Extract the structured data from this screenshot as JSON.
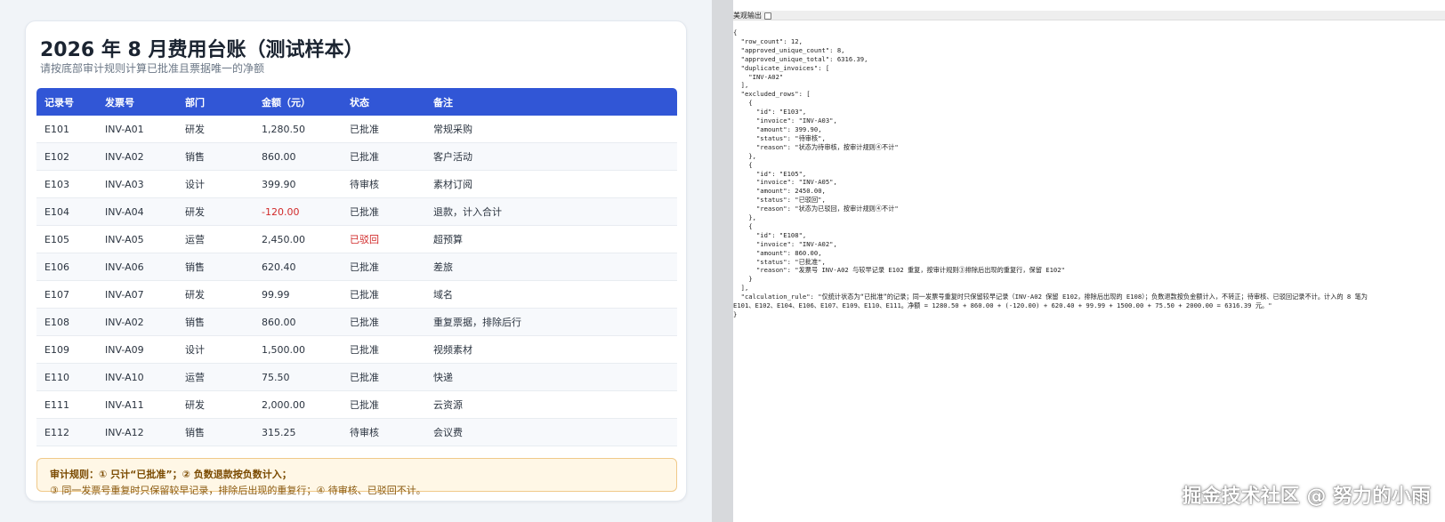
{
  "left": {
    "title": "2026 年 8 月费用台账（测试样本）",
    "subtitle": "请按底部审计规则计算已批准且票据唯一的净额",
    "columns": [
      "记录号",
      "发票号",
      "部门",
      "金额（元）",
      "状态",
      "备注"
    ],
    "rows": [
      {
        "id": "E101",
        "invoice": "INV-A01",
        "dept": "研发",
        "amount": "1,280.50",
        "status": "已批准",
        "note": "常规采购"
      },
      {
        "id": "E102",
        "invoice": "INV-A02",
        "dept": "销售",
        "amount": "860.00",
        "status": "已批准",
        "note": "客户活动"
      },
      {
        "id": "E103",
        "invoice": "INV-A03",
        "dept": "设计",
        "amount": "399.90",
        "status": "待审核",
        "note": "素材订阅"
      },
      {
        "id": "E104",
        "invoice": "INV-A04",
        "dept": "研发",
        "amount": "-120.00",
        "status": "已批准",
        "note": "退款，计入合计"
      },
      {
        "id": "E105",
        "invoice": "INV-A05",
        "dept": "运营",
        "amount": "2,450.00",
        "status": "已驳回",
        "note": "超预算"
      },
      {
        "id": "E106",
        "invoice": "INV-A06",
        "dept": "销售",
        "amount": "620.40",
        "status": "已批准",
        "note": "差旅"
      },
      {
        "id": "E107",
        "invoice": "INV-A07",
        "dept": "研发",
        "amount": "99.99",
        "status": "已批准",
        "note": "域名"
      },
      {
        "id": "E108",
        "invoice": "INV-A02",
        "dept": "销售",
        "amount": "860.00",
        "status": "已批准",
        "note": "重复票据，排除后行"
      },
      {
        "id": "E109",
        "invoice": "INV-A09",
        "dept": "设计",
        "amount": "1,500.00",
        "status": "已批准",
        "note": "视频素材"
      },
      {
        "id": "E110",
        "invoice": "INV-A10",
        "dept": "运营",
        "amount": "75.50",
        "status": "已批准",
        "note": "快递"
      },
      {
        "id": "E111",
        "invoice": "INV-A11",
        "dept": "研发",
        "amount": "2,000.00",
        "status": "已批准",
        "note": "云资源"
      },
      {
        "id": "E112",
        "invoice": "INV-A12",
        "dept": "销售",
        "amount": "315.25",
        "status": "待审核",
        "note": "会议费"
      }
    ],
    "rule_line1": "审计规则：① 只计“已批准”；② 负数退款按负数计入；",
    "rule_line2": "③ 同一发票号重复时只保留较早记录，排除后出现的重复行；④ 待审核、已驳回不计。"
  },
  "right": {
    "pretty_label": "美观输出",
    "json_text": "{\n  \"row_count\": 12,\n  \"approved_unique_count\": 8,\n  \"approved_unique_total\": 6316.39,\n  \"duplicate_invoices\": [\n    \"INV-A02\"\n  ],\n  \"excluded_rows\": [\n    {\n      \"id\": \"E103\",\n      \"invoice\": \"INV-A03\",\n      \"amount\": 399.90,\n      \"status\": \"待审核\",\n      \"reason\": \"状态为待审核，按审计规则④不计\"\n    },\n    {\n      \"id\": \"E105\",\n      \"invoice\": \"INV-A05\",\n      \"amount\": 2450.00,\n      \"status\": \"已驳回\",\n      \"reason\": \"状态为已驳回，按审计规则④不计\"\n    },\n    {\n      \"id\": \"E108\",\n      \"invoice\": \"INV-A02\",\n      \"amount\": 860.00,\n      \"status\": \"已批准\",\n      \"reason\": \"发票号 INV-A02 与较早记录 E102 重复，按审计规则③排除后出现的重复行，保留 E102\"\n    }\n  ],\n  \"calculation_rule\": \"仅统计状态为“已批准”的记录；同一发票号重复时只保留较早记录（INV-A02 保留 E102，排除后出现的 E108）；负数退款按负金额计入，不转正；待审核、已驳回记录不计。计入的 8 笔为\nE101、E102、E104、E106、E107、E109、E110、E111。净额 = 1280.50 + 860.00 + (-120.00) + 620.40 + 99.99 + 1500.00 + 75.50 + 2000.00 = 6316.39 元。\"\n}"
  },
  "watermark": "掘金技术社区 @ 努力的小雨",
  "colors": {
    "header_blue": "#3156d6",
    "negative_red": "#d12a2a",
    "rule_bg": "#fff7e6"
  }
}
